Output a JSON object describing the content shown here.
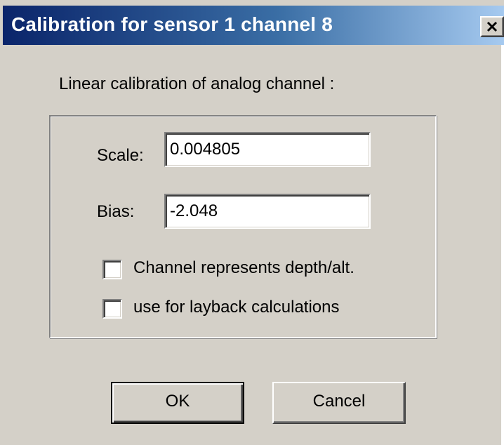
{
  "window": {
    "title": "Calibration for sensor 1 channel 8",
    "close_symbol": "X"
  },
  "main": {
    "heading": "Linear calibration of analog channel :",
    "scale": {
      "label": "Scale:",
      "value": "0.004805"
    },
    "bias": {
      "label": "Bias:",
      "value": "-2.048"
    },
    "checkboxes": [
      {
        "label": "Channel represents depth/alt.",
        "checked": false
      },
      {
        "label": "use for layback calculations",
        "checked": false
      }
    ]
  },
  "buttons": {
    "ok_label": "OK",
    "cancel_label": "Cancel"
  },
  "icons": {
    "close": "close-icon"
  },
  "colors": {
    "titlebar_start": "#0a246a",
    "titlebar_end": "#a6caf0",
    "dialog_face": "#d4d0c8"
  }
}
